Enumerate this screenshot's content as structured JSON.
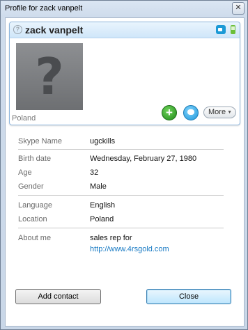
{
  "window": {
    "title": "Profile for zack vanpelt",
    "close_glyph": "✕"
  },
  "card": {
    "display_name": "zack vanpelt",
    "status_icon": "offline-status-icon",
    "status_glyph": "?",
    "avatar_glyph": "?",
    "avatar_location": "Poland",
    "more_label": "More",
    "more_caret": "▼",
    "add_glyph": "+"
  },
  "info": {
    "skype_name_label": "Skype Name",
    "skype_name_value": "ugckills",
    "birth_label": "Birth date",
    "birth_value": "Wednesday, February 27, 1980",
    "age_label": "Age",
    "age_value": "32",
    "gender_label": "Gender",
    "gender_value": "Male",
    "language_label": "Language",
    "language_value": "English",
    "location_label": "Location",
    "location_value": "Poland",
    "about_label": "About me",
    "about_line1": "sales rep for",
    "about_link": "http://www.4rsgold.com"
  },
  "buttons": {
    "add_contact": "Add contact",
    "close": "Close"
  },
  "colors": {
    "link": "#1a7bc4",
    "card_header": "#cfe6f9",
    "add_button": "#1f8a1a",
    "chat_button": "#1f98db"
  }
}
